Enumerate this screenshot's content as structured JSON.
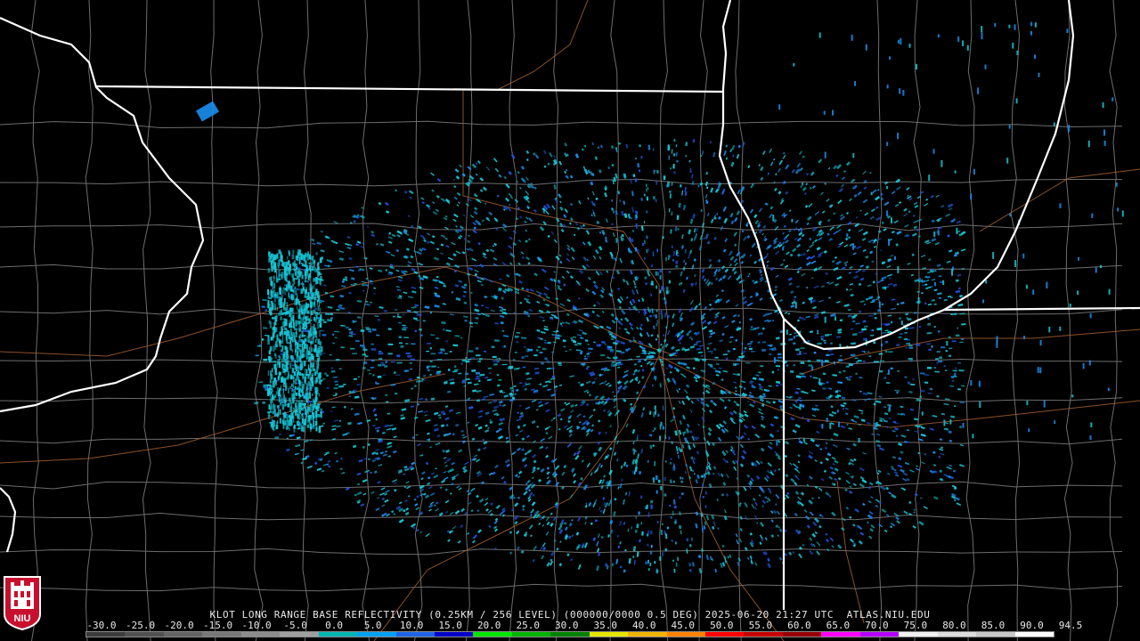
{
  "radar": {
    "caption": "KLOT LONG RANGE BASE REFLECTIVITY (0.25KM / 256 LEVEL) (000000/0000 0.5 DEG) 2025-06-20 21:27 UTC  ATLAS.NIU.EDU"
  },
  "logo": {
    "text": "NIU",
    "background": "#c8102e"
  },
  "colorbar": {
    "labels": [
      "-30.0",
      "-25.0",
      "-20.0",
      "-15.0",
      "-10.0",
      "-5.0",
      "0.0",
      "5.0",
      "10.0",
      "15.0",
      "20.0",
      "25.0",
      "30.0",
      "35.0",
      "40.0",
      "45.0",
      "50.0",
      "55.0",
      "60.0",
      "65.0",
      "70.0",
      "75.0",
      "80.0",
      "85.0",
      "90.0",
      "94.5"
    ],
    "colors": [
      "#3c3c3c",
      "#505050",
      "#646464",
      "#787878",
      "#8c8c8c",
      "#a0a0a0",
      "#00b4b4",
      "#00a0f0",
      "#1e64e6",
      "#0000c8",
      "#00e600",
      "#00b400",
      "#008200",
      "#e6e600",
      "#f0b400",
      "#ff8200",
      "#ff0000",
      "#c80000",
      "#960000",
      "#ff00ff",
      "#b400ff",
      "#f0f0f0",
      "#dcdcdc",
      "#c8c8c8",
      "#ffffff"
    ]
  },
  "colors": {
    "background": "#000000",
    "state_lines": "#ffffff",
    "county_lines": "#808080",
    "roads": "#9b5a2e",
    "echo_light": "#16c8d8",
    "echo_mid": "#1a8ff0",
    "echo_strong": "#2055e0"
  }
}
